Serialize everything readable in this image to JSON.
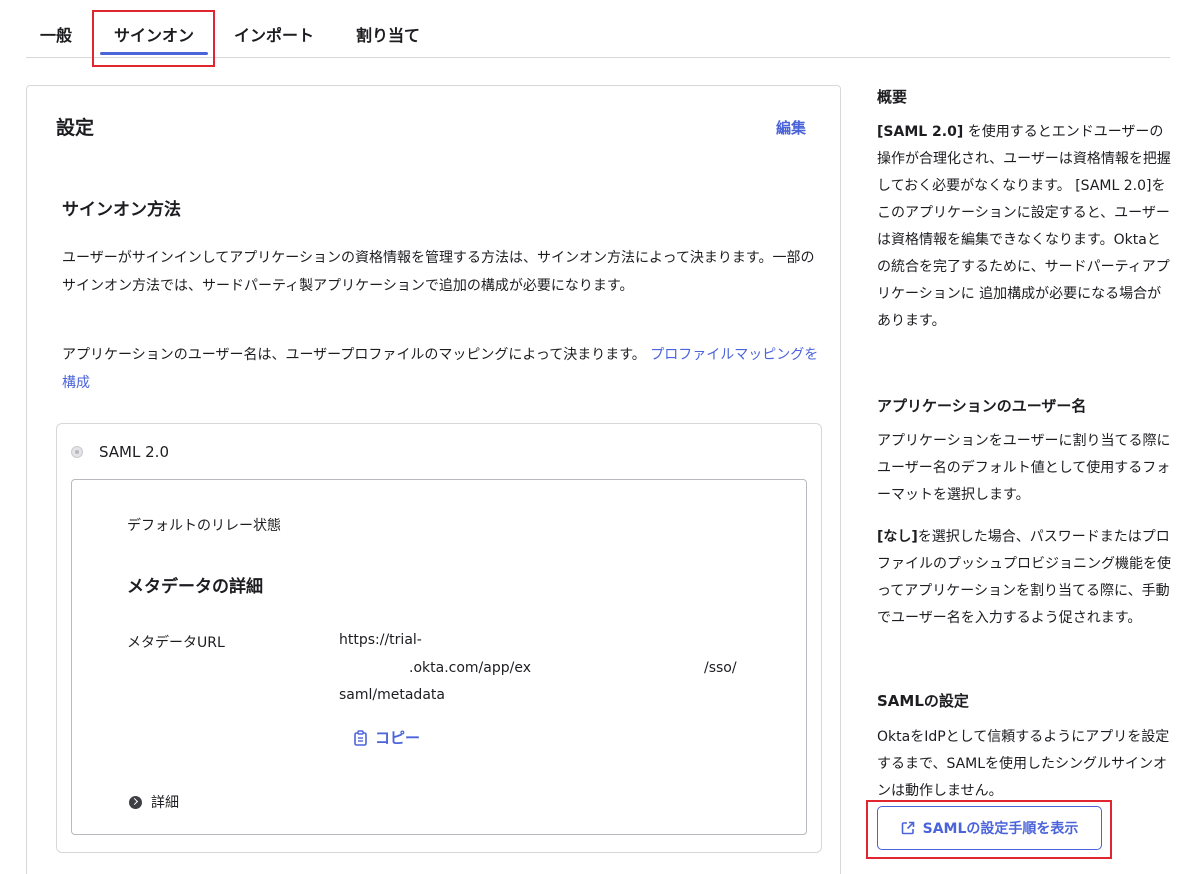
{
  "tabs": {
    "general": "一般",
    "signon": "サインオン",
    "import": "インポート",
    "assign": "割り当て"
  },
  "settings": {
    "title": "設定",
    "edit": "編集",
    "signon_method_title": "サインオン方法",
    "para1": "ユーザーがサインインしてアプリケーションの資格情報を管理する方法は、サインオン方法によって決まります。一部のサインオン方法では、サードパーティ製アプリケーションで追加の構成が必要になります。",
    "para2_text": "アプリケーションのユーザー名は、ユーザープロファイルのマッピングによって決まります。",
    "para2_link": "プロファイルマッピングを構成",
    "saml_option": "SAML 2.0",
    "relay_state_label": "デフォルトのリレー状態",
    "metadata_title": "メタデータの詳細",
    "metadata_url_label": "メタデータURL",
    "metadata_url_line1": "https://trial-",
    "metadata_url_line2": ".okta.com/app/ex",
    "metadata_url_line2b": "/sso/",
    "metadata_url_line3": "saml/metadata",
    "copy": "コピー",
    "details": "詳細"
  },
  "sidebar": {
    "overview_title": "概要",
    "overview_bold": "[SAML 2.0]",
    "overview_text": " を使用するとエンドユーザーの操作が合理化され、ユーザーは資格情報を把握しておく必要がなくなります。 [SAML 2.0]をこのアプリケーションに設定すると、ユーザーは資格情報を編集できなくなります。Oktaとの統合を完了するために、サードパーティアプリケーションに 追加構成が必要になる場合があります。",
    "username_title": "アプリケーションのユーザー名",
    "username_text": "アプリケーションをユーザーに割り当てる際にユーザー名のデフォルト値として使用するフォーマットを選択します。",
    "none_bold": "[なし]",
    "none_text": "を選択した場合、パスワードまたはプロファイルのプッシュプロビジョニング機能を使ってアプリケーションを割り当てる際に、手動でユーザー名を入力するよう促されます。",
    "saml_settings_title": "SAMLの設定",
    "saml_settings_text": "OktaをIdPとして信頼するようにアプリを設定するまで、SAMLを使用したシングルサインオンは動作しません。",
    "saml_button": "SAMLの設定手順を表示"
  },
  "colors": {
    "accent": "#4c64d9",
    "highlight": "#e0262f"
  },
  "icons": {
    "copy": "clipboard-icon",
    "details": "chevron-right-circle-icon",
    "external": "external-link-icon"
  }
}
